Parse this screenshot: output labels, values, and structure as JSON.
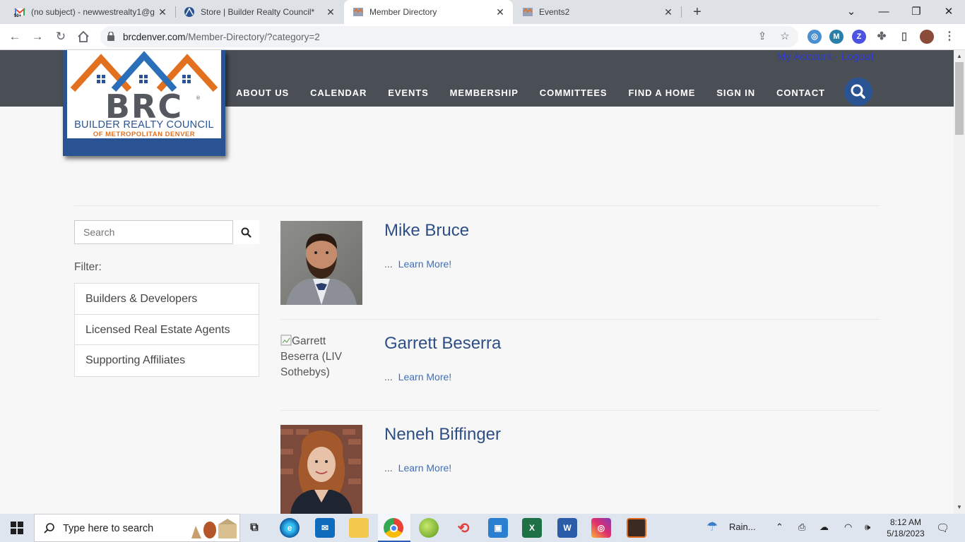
{
  "browser": {
    "tabs": [
      {
        "title": "(no subject) - newwestrealty1@g",
        "active": false
      },
      {
        "title": "Store | Builder Realty Council*",
        "active": false
      },
      {
        "title": "Member Directory",
        "active": true
      },
      {
        "title": "Events2",
        "active": false
      }
    ],
    "url_domain": "brcdenver.com",
    "url_path": "/Member-Directory/?category=2"
  },
  "site": {
    "account_link": "My Account",
    "account_sep": "-",
    "logout_link": "Logout",
    "logo_letters": "BRC",
    "logo_line1": "BUILDER REALTY COUNCIL",
    "logo_line2": "OF METROPOLITAN DENVER",
    "nav": [
      "ABOUT US",
      "CALENDAR",
      "EVENTS",
      "MEMBERSHIP",
      "COMMITTEES",
      "FIND A HOME",
      "SIGN IN",
      "CONTACT"
    ]
  },
  "sidebar": {
    "search_placeholder": "Search",
    "filter_label": "Filter:",
    "filters": [
      "Builders & Developers",
      "Licensed Real Estate Agents",
      "Supporting Affiliates"
    ]
  },
  "members": [
    {
      "name": "Mike Bruce",
      "ellipsis": "...",
      "link": "Learn More!",
      "photo_alt": ""
    },
    {
      "name": "Garrett Beserra",
      "ellipsis": "...",
      "link": "Learn More!",
      "photo_alt": "Garrett Beserra (LIV Sothebys)"
    },
    {
      "name": "Neneh Biffinger",
      "ellipsis": "...",
      "link": "Learn More!",
      "photo_alt": ""
    }
  ],
  "taskbar": {
    "search_text": "Type here to search",
    "weather": "Rain...",
    "time": "8:12 AM",
    "date": "5/18/2023"
  }
}
